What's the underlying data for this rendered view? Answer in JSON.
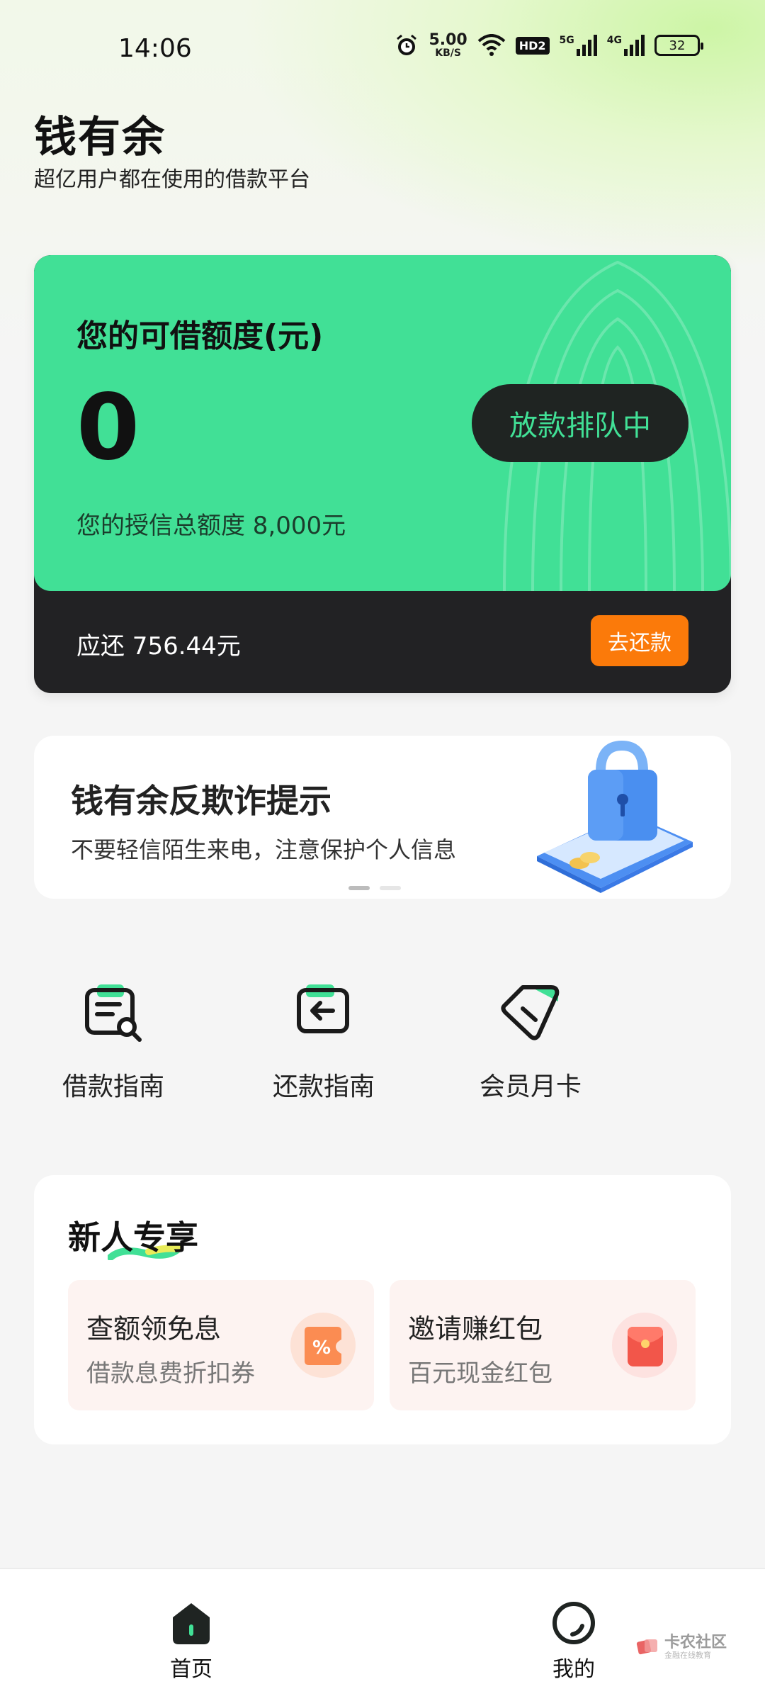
{
  "status_bar": {
    "time": "14:06",
    "net_speed_value": "5.00",
    "net_speed_unit": "KB/S",
    "hd_label": "HD2",
    "sig1_label": "5G",
    "sig2_label": "4G",
    "battery": "32",
    "icons": [
      "alarm-icon",
      "wifi-icon",
      "signal-icon",
      "battery-icon"
    ]
  },
  "header": {
    "app_name": "钱有余",
    "subtitle": "超亿用户都在使用的借款平台"
  },
  "credit_card": {
    "label": "您的可借额度(元)",
    "amount": "0",
    "queue_button": "放款排队中",
    "total_credit": "您的授信总额度 8,000元",
    "repay_due": "应还 756.44元",
    "repay_button": "去还款"
  },
  "banner": {
    "title": "钱有余反欺诈提示",
    "subtitle": "不要轻信陌生来电，注意保护个人信息",
    "page_count": 2,
    "active_page": 1
  },
  "quick_actions": [
    {
      "label": "借款指南",
      "icon": "loan-guide-icon"
    },
    {
      "label": "还款指南",
      "icon": "repay-guide-icon"
    },
    {
      "label": "会员月卡",
      "icon": "member-card-icon"
    }
  ],
  "newbie": {
    "title": "新人专享",
    "promos": [
      {
        "title": "查额领免息",
        "subtitle": "借款息费折扣券",
        "icon": "discount-coupon-icon"
      },
      {
        "title": "邀请赚红包",
        "subtitle": "百元现金红包",
        "icon": "red-envelope-icon"
      }
    ]
  },
  "bottom_nav": {
    "home": "首页",
    "mine": "我的",
    "active": "home"
  },
  "watermark": {
    "main": "卡农社区",
    "sub": "金融在线教育"
  },
  "colors": {
    "brand_green": "#41e096",
    "dark": "#222224",
    "orange": "#fb7a0a"
  }
}
